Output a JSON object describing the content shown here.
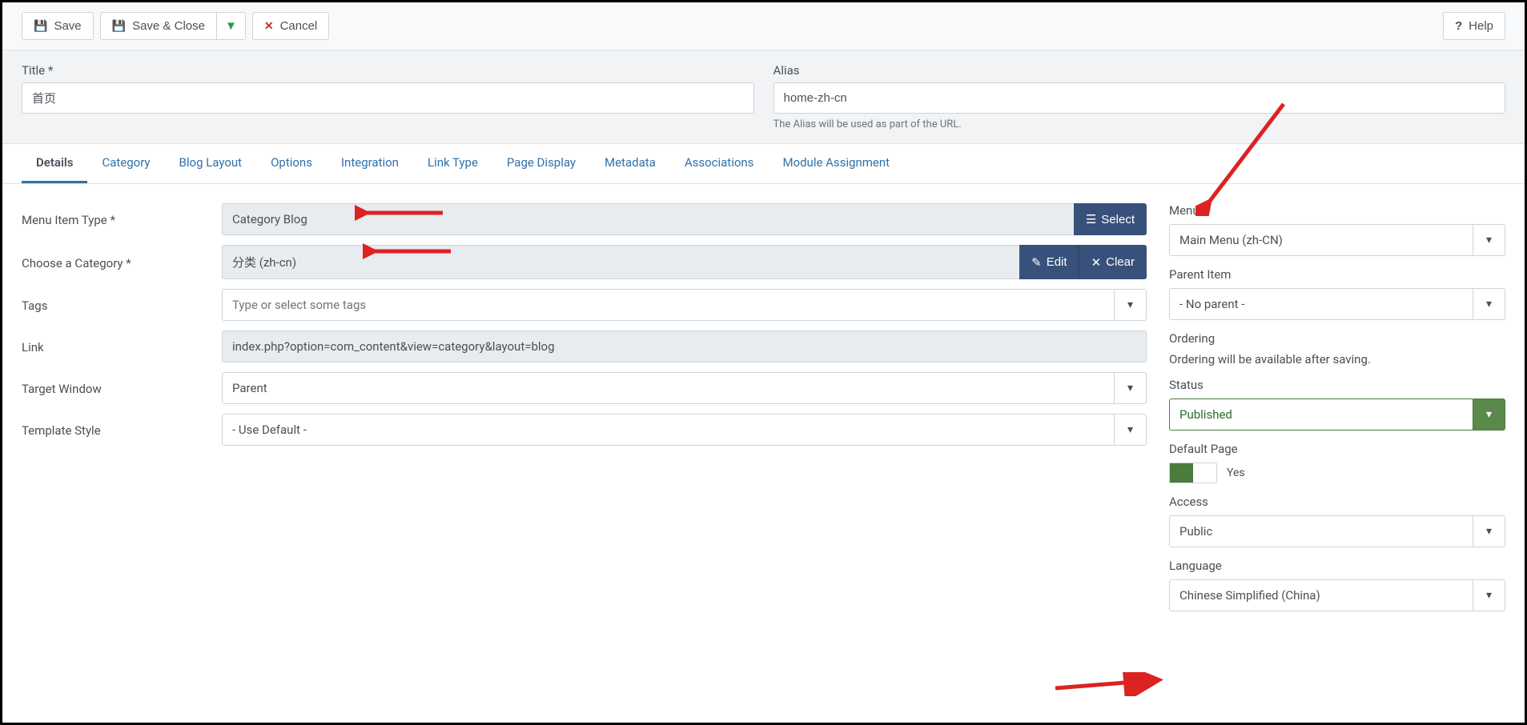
{
  "toolbar": {
    "save": "Save",
    "save_close": "Save & Close",
    "cancel": "Cancel",
    "help": "Help"
  },
  "header": {
    "title_label": "Title *",
    "title_value": "首页",
    "alias_label": "Alias",
    "alias_value": "home-zh-cn",
    "alias_help": "The Alias will be used as part of the URL."
  },
  "tabs": [
    "Details",
    "Category",
    "Blog Layout",
    "Options",
    "Integration",
    "Link Type",
    "Page Display",
    "Metadata",
    "Associations",
    "Module Assignment"
  ],
  "form": {
    "menu_item_type_label": "Menu Item Type *",
    "menu_item_type_value": "Category Blog",
    "select_btn": "Select",
    "choose_category_label": "Choose a Category *",
    "choose_category_value": "分类 (zh-cn)",
    "edit_btn": "Edit",
    "clear_btn": "Clear",
    "tags_label": "Tags",
    "tags_placeholder": "Type or select some tags",
    "link_label": "Link",
    "link_value": "index.php?option=com_content&view=category&layout=blog",
    "target_window_label": "Target Window",
    "target_window_value": "Parent",
    "template_style_label": "Template Style",
    "template_style_value": "- Use Default -"
  },
  "sidebar": {
    "menu_label": "Menu *",
    "menu_value": "Main Menu (zh-CN)",
    "parent_label": "Parent Item",
    "parent_value": "- No parent -",
    "ordering_label": "Ordering",
    "ordering_desc": "Ordering will be available after saving.",
    "status_label": "Status",
    "status_value": "Published",
    "default_page_label": "Default Page",
    "default_page_value": "Yes",
    "access_label": "Access",
    "access_value": "Public",
    "language_label": "Language",
    "language_value": "Chinese Simplified (China)"
  }
}
